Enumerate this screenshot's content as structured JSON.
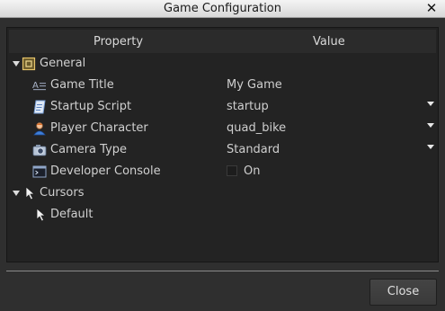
{
  "window": {
    "title": "Game Configuration"
  },
  "table": {
    "headers": {
      "property": "Property",
      "value": "Value"
    },
    "groups": {
      "general": {
        "label": "General",
        "rows": {
          "title": {
            "label": "Game Title",
            "value": "My Game",
            "icon": "text-icon"
          },
          "script": {
            "label": "Startup Script",
            "value": "startup",
            "icon": "script-icon"
          },
          "player": {
            "label": "Player Character",
            "value": "quad_bike",
            "icon": "person-icon"
          },
          "camera": {
            "label": "Camera Type",
            "value": "Standard",
            "icon": "camera-icon"
          },
          "console": {
            "label": "Developer Console",
            "value": "On",
            "icon": "console-icon"
          }
        }
      },
      "cursors": {
        "label": "Cursors",
        "rows": {
          "default": {
            "label": "Default",
            "icon": "cursor-icon"
          }
        }
      }
    }
  },
  "footer": {
    "close_label": "Close"
  }
}
